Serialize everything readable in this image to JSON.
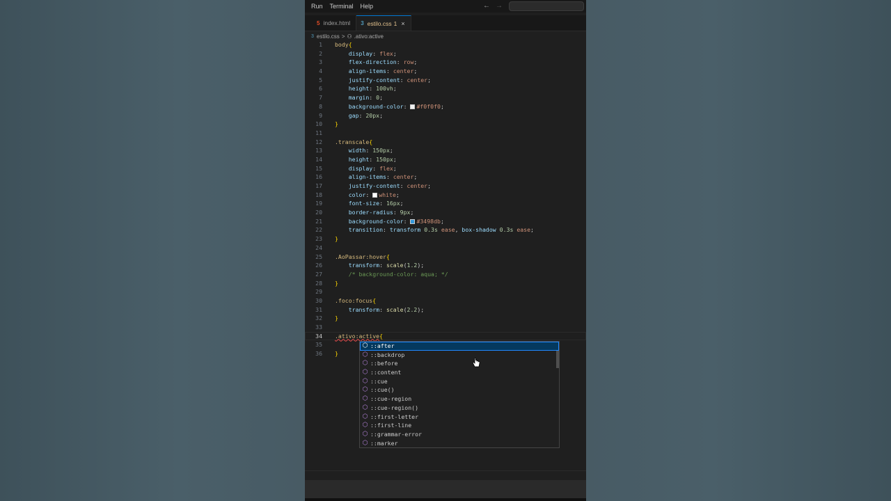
{
  "menubar": {
    "items": [
      "Run",
      "Terminal",
      "Help"
    ],
    "back": "←",
    "forward": "→"
  },
  "tabs": [
    {
      "label": "index.html",
      "icon": "html-icon",
      "icon_glyph": "5"
    },
    {
      "label": "estilo.css",
      "badge": "1",
      "icon": "css-icon",
      "icon_glyph": "3",
      "close": "×",
      "active": true
    }
  ],
  "breadcrumb": {
    "file": "estilo.css",
    "separator": ">",
    "symbol": ".ativo:active"
  },
  "code": {
    "l1": "1",
    "l2": "2",
    "l3": "3",
    "l4": "4",
    "l5": "5",
    "l6": "6",
    "l7": "7",
    "l8": "8",
    "l9": "9",
    "l10": "10",
    "l11": "11",
    "l12": "12",
    "l13": "13",
    "l14": "14",
    "l15": "15",
    "l16": "16",
    "l17": "17",
    "l18": "18",
    "l19": "19",
    "l20": "20",
    "l21": "21",
    "l22": "22",
    "l23": "23",
    "l24": "24",
    "l25": "25",
    "l26": "26",
    "l27": "27",
    "l28": "28",
    "l29": "29",
    "l30": "30",
    "l31": "31",
    "l32": "32",
    "l33": "33",
    "l34": "34",
    "l35": "35",
    "l36": "36",
    "body_sel": "body",
    "open": "{",
    "close": "}",
    "colon": ": ",
    "semi": ";",
    "comma": ", ",
    "display": "display",
    "flex": "flex",
    "flex_direction": "flex-direction",
    "row": "row",
    "align_items": "align-items",
    "center": "center",
    "justify_content": "justify-content",
    "height": "height",
    "v100vh": "100vh",
    "margin": "margin",
    "v0": "0",
    "background_color": "background-color",
    "f0": "#f0f0f0",
    "gap": "gap",
    "v20px": "20px",
    "transcale_sel": ".transcale",
    "width": "width",
    "v150px": "150px",
    "color": "color",
    "white": "white",
    "font_size": "font-size",
    "v16px": "16px",
    "border_radius": "border-radius",
    "v9px": "9px",
    "c3498db": "#3498db",
    "transition": "transition",
    "transform": "transform",
    "v03s": "0.3s",
    "ease": "ease",
    "box_shadow": "box-shadow",
    "hover_sel": ".AoPassar:hover",
    "scale": "scale",
    "paren_open": "(",
    "paren_close": ")",
    "v12": "1.2",
    "comment": "/* background-color: aqua; */",
    "focus_sel": ".foco:focus",
    "v22": "2.2",
    "active_sel": ".ativo:active"
  },
  "suggestions": [
    "::after",
    "::backdrop",
    "::before",
    "::content",
    "::cue",
    "::cue()",
    "::cue-region",
    "::cue-region()",
    "::first-letter",
    "::first-line",
    "::grammar-error",
    "::marker"
  ],
  "colors": {
    "swatch_f0": "#f0f0f0",
    "swatch_white": "#ffffff",
    "swatch_blue": "#3498db",
    "accent": "#0078d4"
  },
  "icons": {
    "suggestion": "cube-icon",
    "cursor": "hand-pointer-icon"
  }
}
